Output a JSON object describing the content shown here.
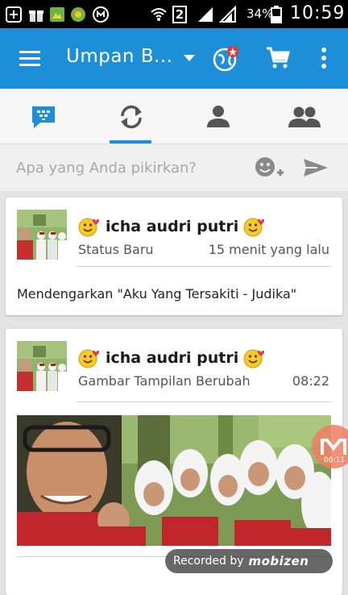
{
  "status_bar": {
    "battery_percent": "34%",
    "time": "10:59",
    "sim_slot": "2"
  },
  "app_bar": {
    "title": "Umpan B...",
    "icons": [
      "menu-icon",
      "dropdown-caret-icon",
      "globe-notification-icon",
      "cart-icon",
      "more-vert-icon"
    ]
  },
  "tabs": [
    {
      "name": "bbm-chat",
      "icon": "bbm-chat-icon"
    },
    {
      "name": "updates",
      "icon": "refresh-icon",
      "active": true
    },
    {
      "name": "contact",
      "icon": "person-icon"
    },
    {
      "name": "groups",
      "icon": "people-icon"
    }
  ],
  "composer": {
    "placeholder": "Apa yang Anda pikirkan?"
  },
  "feed": [
    {
      "name": "icha audri putri",
      "subtitle": "Status Baru",
      "time": "15 menit yang lalu",
      "message": "Mendengarkan \"Aku Yang Tersakiti - Judika\""
    },
    {
      "name": "icha audri putri",
      "subtitle": "Gambar Tampilan Berubah",
      "time": "08:22"
    }
  ],
  "overlays": {
    "recorded_by": "Recorded by",
    "recorder_brand": "mobizen",
    "float_timer": "00:11"
  },
  "colors": {
    "accent": "#1c8fd8",
    "status_bar": "#000000",
    "background": "#e3e3e3"
  }
}
